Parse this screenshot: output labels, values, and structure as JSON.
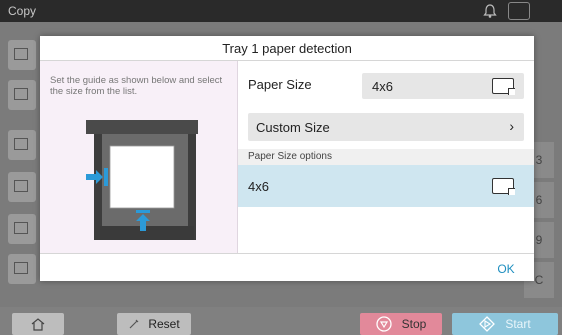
{
  "app": {
    "title": "Copy"
  },
  "dialog": {
    "title": "Tray 1 paper detection",
    "instructions": "Set the guide as shown below and select the size from the list.",
    "paper_size_label": "Paper Size",
    "paper_size_value": "4x6",
    "custom_size_label": "Custom Size",
    "options_header": "Paper Size options",
    "options": [
      {
        "label": "4x6",
        "selected": true
      }
    ],
    "ok_label": "OK"
  },
  "background": {
    "keys": [
      "3",
      "6",
      "9",
      "C"
    ]
  },
  "bottom": {
    "reset_label": "Reset",
    "stop_label": "Stop",
    "start_label": "Start"
  },
  "colors": {
    "accent": "#1f8fc0",
    "selected_row": "#cfe6f0",
    "stop": "#e2899a",
    "start": "#8ec6dc",
    "guide_arrow": "#2b9ad8"
  },
  "icons": {
    "home": "home-icon",
    "reset": "pencil-icon",
    "stop": "stop-icon",
    "start": "start-icon",
    "bell": "bell-icon",
    "fax": "fax-icon",
    "paper": "paper-landscape-icon"
  }
}
